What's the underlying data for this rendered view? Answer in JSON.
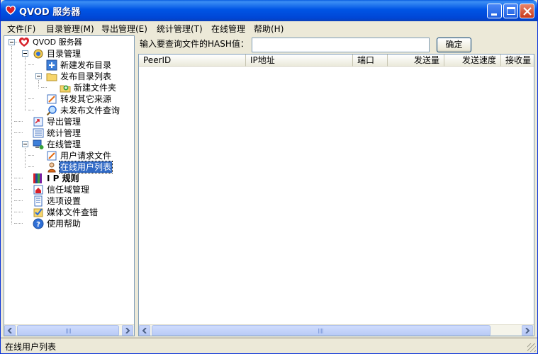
{
  "window": {
    "title": "QVOD 服务器"
  },
  "menu": [
    {
      "label": "文件(F)"
    },
    {
      "label": "目录管理(M)"
    },
    {
      "label": "导出管理(E)"
    },
    {
      "label": "统计管理(T)"
    },
    {
      "label": "在线管理"
    },
    {
      "label": "帮助(H)"
    }
  ],
  "tree": {
    "root": "QVOD 服务器",
    "items": [
      {
        "label": "目录管理",
        "icon": "directory-manage-icon"
      },
      {
        "label": "新建发布目录",
        "icon": "new-publish-dir-icon"
      },
      {
        "label": "发布目录列表",
        "icon": "folder-icon"
      },
      {
        "label": "新建文件夹",
        "icon": "new-folder-icon"
      },
      {
        "label": "转发其它来源",
        "icon": "forward-icon"
      },
      {
        "label": "未发布文件查询",
        "icon": "search-icon"
      },
      {
        "label": "导出管理",
        "icon": "export-icon"
      },
      {
        "label": "统计管理",
        "icon": "stats-icon"
      },
      {
        "label": "在线管理",
        "icon": "online-manage-icon"
      },
      {
        "label": "用户请求文件",
        "icon": "user-request-icon"
      },
      {
        "label": "在线用户列表",
        "icon": "online-user-icon"
      },
      {
        "label": "I P 规则",
        "icon": "ip-rule-icon"
      },
      {
        "label": "信任域管理",
        "icon": "trust-domain-icon"
      },
      {
        "label": "选项设置",
        "icon": "options-icon"
      },
      {
        "label": "媒体文件查错",
        "icon": "media-check-icon"
      },
      {
        "label": "使用帮助",
        "icon": "help-icon"
      }
    ]
  },
  "query": {
    "label": "输入要查询文件的HASH值：",
    "value": "",
    "button": "确定"
  },
  "table": {
    "columns": [
      "PeerID",
      "IP地址",
      "端口",
      "发送量",
      "发送速度",
      "接收量"
    ]
  },
  "status": {
    "text": "在线用户列表"
  },
  "colors": {
    "selection": "#316ac5",
    "titlebar": "#0055e5"
  }
}
